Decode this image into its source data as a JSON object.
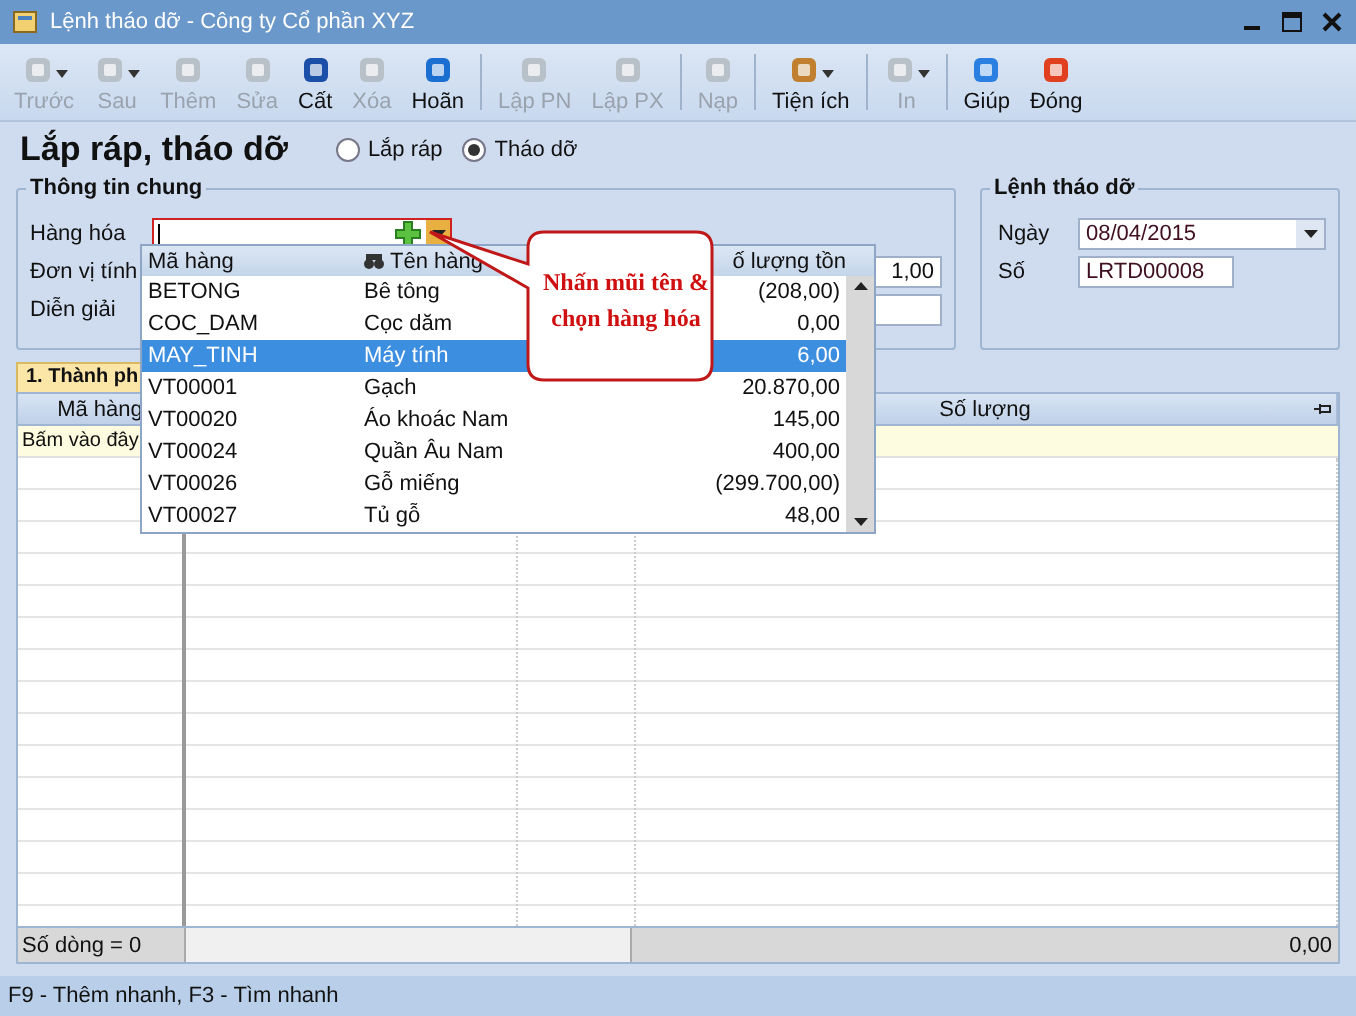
{
  "window": {
    "title": "Lệnh tháo dỡ - Công ty Cổ phần XYZ"
  },
  "toolbar": [
    {
      "label": "Trước",
      "disabled": true,
      "caret": true
    },
    {
      "label": "Sau",
      "disabled": true,
      "caret": true
    },
    {
      "label": "Thêm",
      "disabled": true,
      "caret": false
    },
    {
      "label": "Sửa",
      "disabled": true,
      "caret": false
    },
    {
      "label": "Cất",
      "disabled": false,
      "caret": false
    },
    {
      "label": "Xóa",
      "disabled": true,
      "caret": false
    },
    {
      "label": "Hoãn",
      "disabled": false,
      "caret": false
    },
    {
      "label": "Lập PN",
      "disabled": true,
      "caret": false
    },
    {
      "label": "Lập PX",
      "disabled": true,
      "caret": false
    },
    {
      "label": "Nạp",
      "disabled": true,
      "caret": false
    },
    {
      "label": "Tiện ích",
      "disabled": false,
      "caret": true
    },
    {
      "label": "In",
      "disabled": true,
      "caret": true
    },
    {
      "label": "Giúp",
      "disabled": false,
      "caret": false
    },
    {
      "label": "Đóng",
      "disabled": false,
      "caret": false
    }
  ],
  "page_title": "Lắp ráp, tháo dỡ",
  "mode_options": [
    {
      "label": "Lắp ráp",
      "selected": false
    },
    {
      "label": "Tháo dỡ",
      "selected": true
    }
  ],
  "general": {
    "title": "Thông tin chung",
    "labels": [
      "Hàng hóa",
      "Đơn vị tính",
      "Diễn giải"
    ],
    "quantity_value": "1,00"
  },
  "order": {
    "title": "Lệnh tháo dỡ",
    "date_label": "Ngày",
    "date_value": "08/04/2015",
    "number_label": "Số",
    "number_value": "LRTD00008"
  },
  "dropdown": {
    "columns": [
      "Mã hàng",
      "Tên hàng",
      "ố lượng tồn"
    ],
    "rows": [
      {
        "code": "BETONG",
        "name": "Bê tông",
        "stock": "(208,00)",
        "selected": false
      },
      {
        "code": "COC_DAM",
        "name": "Cọc dăm",
        "stock": "0,00",
        "selected": false
      },
      {
        "code": "MAY_TINH",
        "name": "Máy tính",
        "stock": "6,00",
        "selected": true
      },
      {
        "code": "VT00001",
        "name": "Gạch",
        "stock": "20.870,00",
        "selected": false
      },
      {
        "code": "VT00020",
        "name": "Áo khoác Nam",
        "stock": "145,00",
        "selected": false
      },
      {
        "code": "VT00024",
        "name": "Quần Âu Nam",
        "stock": "400,00",
        "selected": false
      },
      {
        "code": "VT00026",
        "name": "Gỗ miếng",
        "stock": "(299.700,00)",
        "selected": false
      },
      {
        "code": "VT00027",
        "name": "Tủ gỗ",
        "stock": "48,00",
        "selected": false
      }
    ]
  },
  "callout": {
    "lines": [
      "Nhấn mũi tên &",
      "chọn hàng hóa"
    ]
  },
  "tab": {
    "label": "1. Thành ph"
  },
  "grid": {
    "columns": [
      "Mã hàng",
      "Số lượng"
    ],
    "hint": "Bấm vào đây",
    "footer_count": "Số dòng = 0",
    "footer_total": "0,00"
  },
  "status_bar": "F9 - Thêm nhanh, F3 - Tìm nhanh"
}
